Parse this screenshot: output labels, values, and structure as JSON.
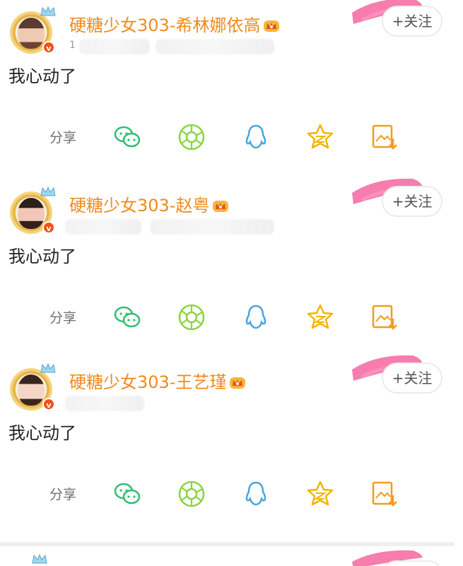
{
  "posts": [
    {
      "username": "硬糖少女303-希林娜依高",
      "meta_visible": "1",
      "follow_label": "+关注",
      "text": "我心动了",
      "share_label": "分享"
    },
    {
      "username": "硬糖少女303-赵粤",
      "follow_label": "+关注",
      "text": "我心动了",
      "share_label": "分享"
    },
    {
      "username": "硬糖少女303-王艺瑾",
      "follow_label": "+关注",
      "text": "我心动了",
      "share_label": "分享"
    }
  ],
  "colors": {
    "username": "#f08a1c",
    "wechat": "#2fbf71",
    "moments": "#8bd43f",
    "qq": "#4aa3df",
    "favorite": "#f4b400",
    "save": "#f29c1f"
  },
  "icons": {
    "share_targets": [
      "wechat-icon",
      "moments-icon",
      "qq-icon",
      "favorite-icon",
      "save-image-icon"
    ],
    "badge": "verified-badge-icon",
    "vip": "vip-crown-icon"
  }
}
